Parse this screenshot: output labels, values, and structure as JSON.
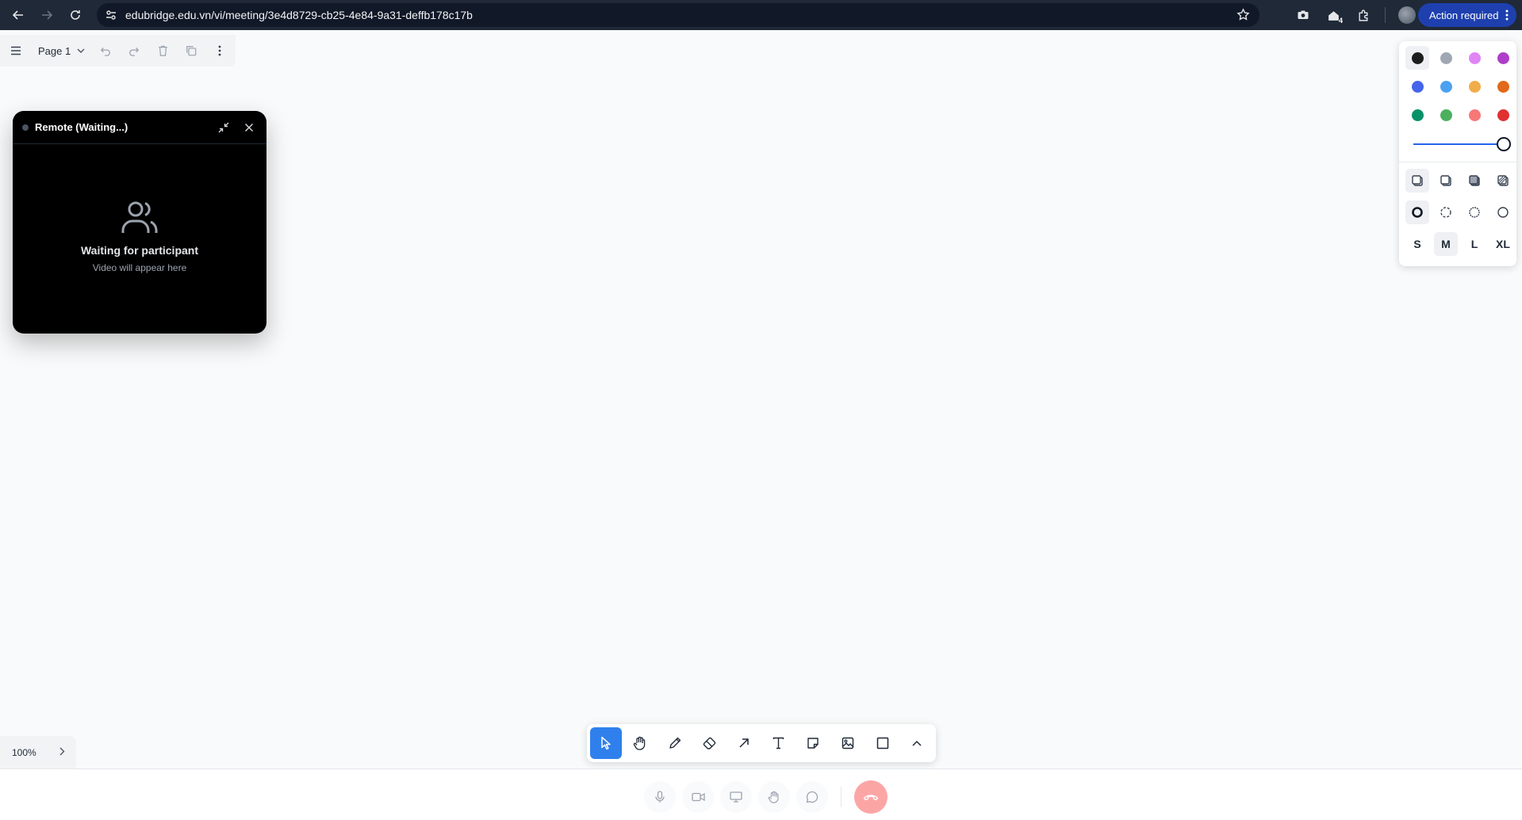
{
  "browser": {
    "url": "edubridge.edu.vn/vi/meeting/3e4d8729-cb25-4e84-9a31-deffb178c17b",
    "action_label": "Action required",
    "extension_badge": "4"
  },
  "toolbar": {
    "page_label": "Page 1"
  },
  "remote": {
    "title": "Remote (Waiting...)",
    "waiting_title": "Waiting for participant",
    "waiting_subtitle": "Video will appear here"
  },
  "style_panel": {
    "colors": [
      {
        "name": "black",
        "hex": "#1d1d1d",
        "selected": true
      },
      {
        "name": "grey",
        "hex": "#9fa8b2",
        "selected": false
      },
      {
        "name": "light-violet",
        "hex": "#e085f4",
        "selected": false
      },
      {
        "name": "violet",
        "hex": "#ae3ec9",
        "selected": false
      },
      {
        "name": "blue",
        "hex": "#4465e9",
        "selected": false
      },
      {
        "name": "light-blue",
        "hex": "#4ba1f1",
        "selected": false
      },
      {
        "name": "yellow",
        "hex": "#f1ac4b",
        "selected": false
      },
      {
        "name": "orange",
        "hex": "#e16919",
        "selected": false
      },
      {
        "name": "green",
        "hex": "#099268",
        "selected": false
      },
      {
        "name": "light-green",
        "hex": "#4cb05e",
        "selected": false
      },
      {
        "name": "light-red",
        "hex": "#f87777",
        "selected": false
      },
      {
        "name": "red",
        "hex": "#e03131",
        "selected": false
      }
    ],
    "opacity": 1.0,
    "sizes": [
      "S",
      "M",
      "L",
      "XL"
    ],
    "selected_size": "M"
  },
  "zoom": {
    "level": "100%"
  },
  "accent_color": "#2f80ed",
  "end_call_color": "#fca5a5"
}
